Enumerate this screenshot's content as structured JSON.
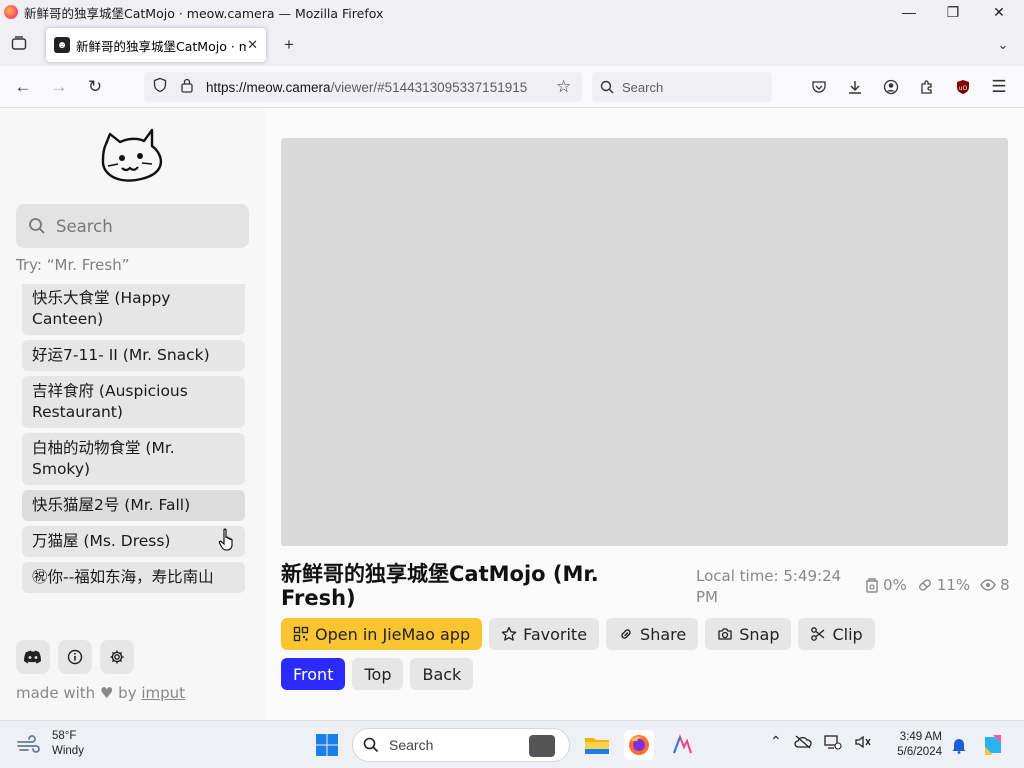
{
  "window": {
    "title": "新鲜哥的独享城堡CatMojo · meow.camera — Mozilla Firefox"
  },
  "tab": {
    "label": "新鲜哥的独享城堡CatMojo · m"
  },
  "navbar": {
    "url_host": "https://meow.camera",
    "url_path": "/viewer/#5144313095337151915",
    "search_placeholder": "Search"
  },
  "sidebar": {
    "search_placeholder": "Search",
    "hint": "Try: “Mr. Fresh”",
    "items": [
      {
        "label": "快乐大食堂 (Happy Canteen)"
      },
      {
        "label": "好运7-11- II  (Mr. Snack)"
      },
      {
        "label": "吉祥食府 (Auspicious Restaurant)"
      },
      {
        "label": "白柚的动物食堂 (Mr. Smoky)"
      },
      {
        "label": "快乐猫屋2号 (Mr. Fall)"
      },
      {
        "label": "万猫屋 (Ms. Dress)"
      },
      {
        "label": "㊗你--福如东海，寿比南山"
      }
    ],
    "made_with_prefix": "made with",
    "made_with_by": "by",
    "made_with_author": "imput"
  },
  "main": {
    "cam_title": "新鲜哥的独享城堡CatMojo (Mr. Fresh)",
    "local_time": "Local time: 5:49:24 PM",
    "stats": {
      "food": "0%",
      "battery": "11%",
      "viewers": "8"
    },
    "actions": {
      "open_app": "Open in JieMao app",
      "favorite": "Favorite",
      "share": "Share",
      "snap": "Snap",
      "clip": "Clip"
    },
    "views": {
      "front": "Front",
      "top": "Top",
      "back": "Back"
    }
  },
  "taskbar": {
    "temp": "58°F",
    "condition": "Windy",
    "search": "Search",
    "time": "3:49 AM",
    "date": "5/6/2024"
  },
  "colors": {
    "accent_blue": "#2b2bff",
    "app_yellow": "#fbc531"
  }
}
